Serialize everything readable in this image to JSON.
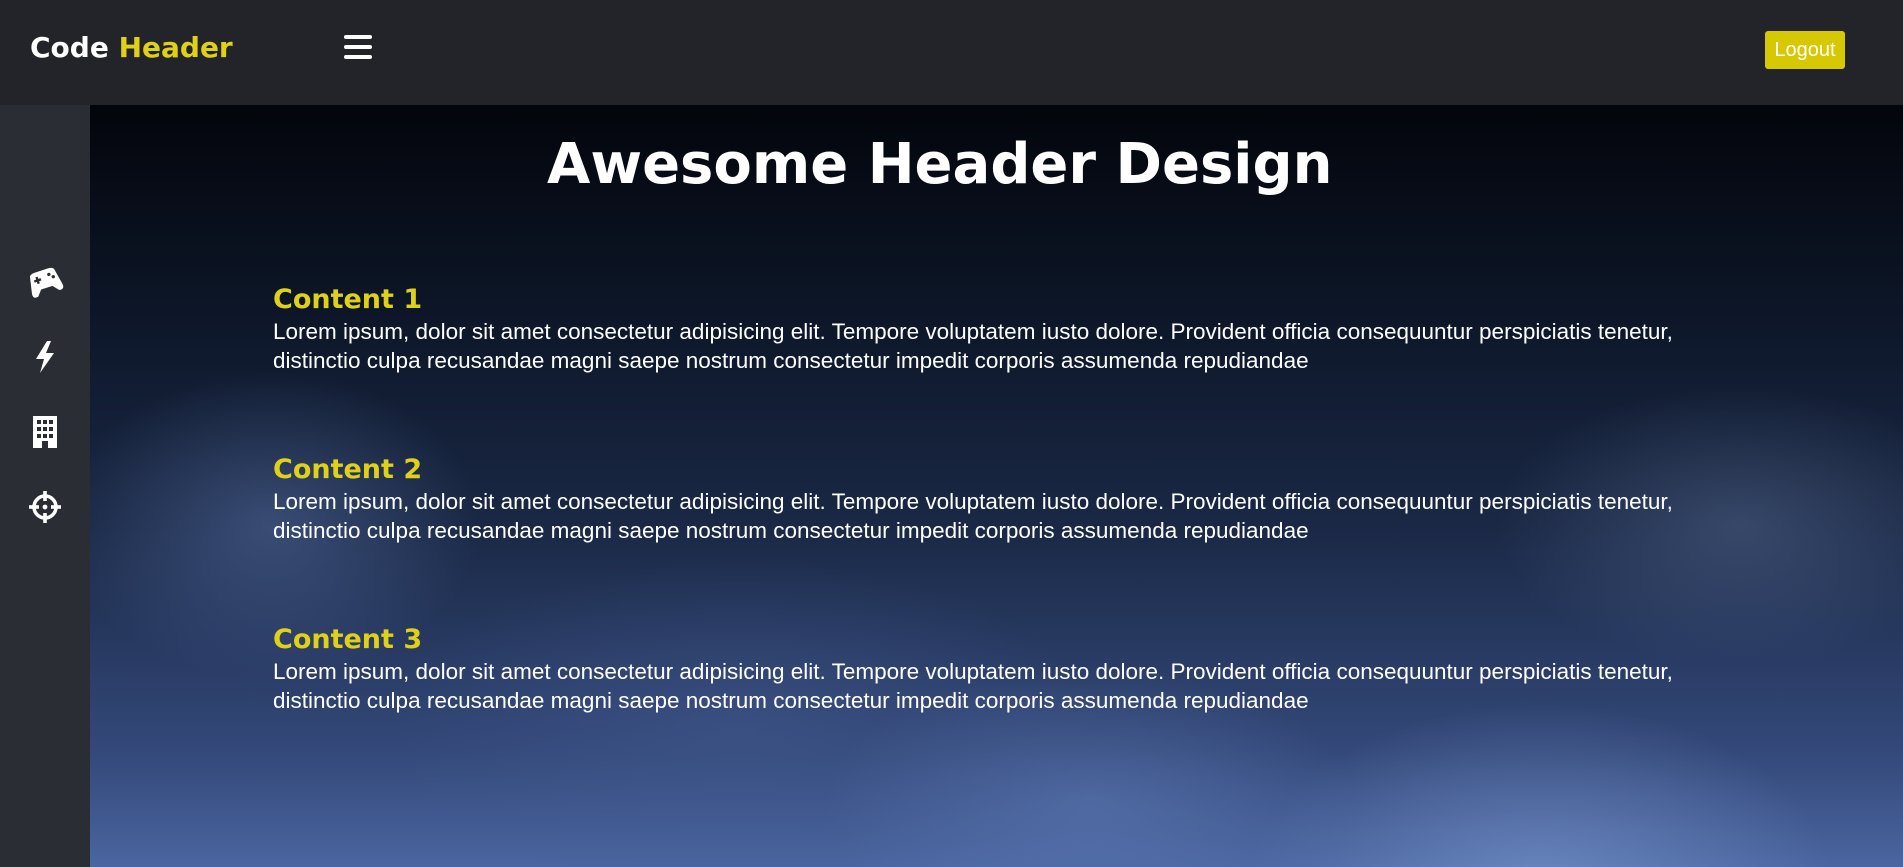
{
  "header": {
    "logo_part1": "Code",
    "logo_part2": "Header",
    "logout_label": "Logout"
  },
  "sidebar": {
    "icons": [
      "gamepad-icon",
      "bolt-icon",
      "building-icon",
      "crosshairs-icon"
    ]
  },
  "main": {
    "title": "Awesome Header Design",
    "sections": [
      {
        "heading": "Content 1",
        "body": "Lorem ipsum, dolor sit amet consectetur adipisicing elit. Tempore voluptatem iusto dolore. Provident officia consequuntur perspiciatis tenetur, distinctio culpa recusandae magni saepe nostrum consectetur impedit corporis assumenda repudiandae"
      },
      {
        "heading": "Content 2",
        "body": "Lorem ipsum, dolor sit amet consectetur adipisicing elit. Tempore voluptatem iusto dolore. Provident officia consequuntur perspiciatis tenetur, distinctio culpa recusandae magni saepe nostrum consectetur impedit corporis assumenda repudiandae"
      },
      {
        "heading": "Content 3",
        "body": "Lorem ipsum, dolor sit amet consectetur adipisicing elit. Tempore voluptatem iusto dolore. Provident officia consequuntur perspiciatis tenetur, distinctio culpa recusandae magni saepe nostrum consectetur impedit corporis assumenda repudiandae"
      }
    ]
  },
  "colors": {
    "accent": "#dfd01a",
    "button": "#d6c903",
    "topbar": "#222429",
    "sidebar": "#2a2d34"
  }
}
